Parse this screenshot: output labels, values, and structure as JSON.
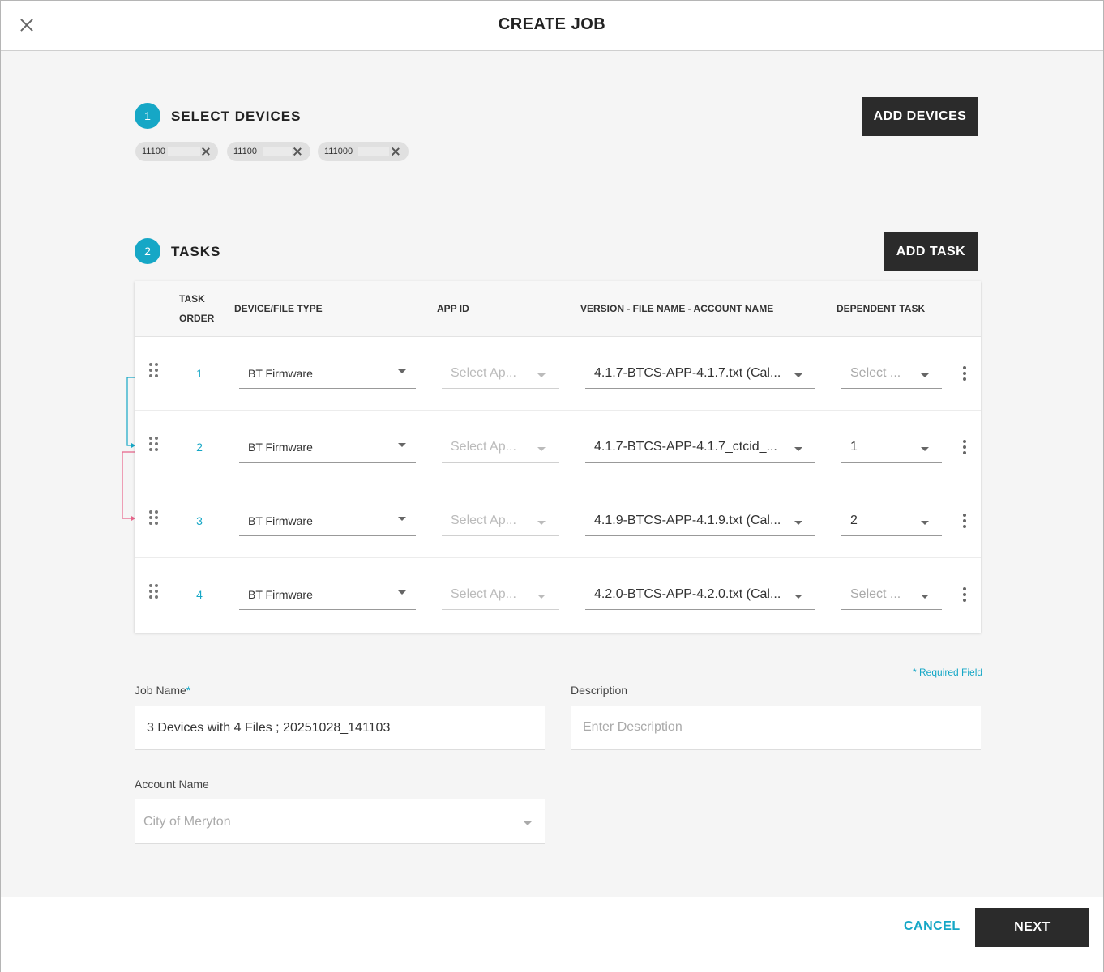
{
  "header": {
    "title": "CREATE JOB"
  },
  "step1": {
    "number": "1",
    "title": "SELECT DEVICES",
    "add_button": "ADD DEVICES",
    "chips": [
      "11100",
      "11100",
      "111000"
    ]
  },
  "step2": {
    "number": "2",
    "title": "TASKS",
    "add_button": "ADD TASK"
  },
  "table": {
    "headers": {
      "task_order_1": "TASK",
      "task_order_2": "ORDER",
      "device_type": "DEVICE/FILE TYPE",
      "app_id": "APP ID",
      "version": "VERSION - FILE NAME - ACCOUNT NAME",
      "dependent": "DEPENDENT TASK"
    },
    "rows": [
      {
        "order": "1",
        "device_type": "BT Firmware",
        "app_id": "Select Ap...",
        "version": "4.1.7-BTCS-APP-4.1.7.txt (Cal...",
        "dependent": "Select ..."
      },
      {
        "order": "2",
        "device_type": "BT Firmware",
        "app_id": "Select Ap...",
        "version": "4.1.7-BTCS-APP-4.1.7_ctcid_...",
        "dependent": "1"
      },
      {
        "order": "3",
        "device_type": "BT Firmware",
        "app_id": "Select Ap...",
        "version": "4.1.9-BTCS-APP-4.1.9.txt (Cal...",
        "dependent": "2"
      },
      {
        "order": "4",
        "device_type": "BT Firmware",
        "app_id": "Select Ap...",
        "version": "4.2.0-BTCS-APP-4.2.0.txt (Cal...",
        "dependent": "Select ..."
      }
    ]
  },
  "form": {
    "required_note": "* Required Field",
    "job_name_label": "Job Name",
    "required_star": "*",
    "job_name_value": "3 Devices with 4 Files ; 20251028_141103",
    "description_label": "Description",
    "description_placeholder": "Enter Description",
    "account_label": "Account Name",
    "account_value": "City of Meryton"
  },
  "footer": {
    "cancel": "CANCEL",
    "next": "NEXT"
  },
  "colors": {
    "accent": "#16a7c6",
    "dark_button": "#2b2b2b",
    "dependency_line_1": "#16a7c6",
    "dependency_line_2": "#e8648a"
  }
}
